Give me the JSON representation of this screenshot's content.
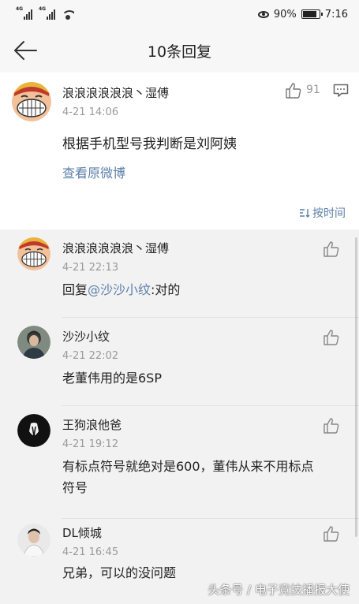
{
  "status_bar": {
    "sim1": "4G",
    "sim2": "4G",
    "battery": "90%",
    "time": "7:16"
  },
  "header": {
    "title": "10条回复",
    "back_icon": "arrow-left-icon"
  },
  "main_comment": {
    "username": "浪浪浪浪浪浪丶湿傅",
    "time": "4-21 14:06",
    "text": "根据手机型号我判断是刘阿姨",
    "like_count": "91",
    "view_original": "查看原微博",
    "sort_label": "按时间"
  },
  "replies": [
    {
      "username": "浪浪浪浪浪浪丶湿傅",
      "time": "4-21 22:13",
      "prefix": "回复",
      "mention": "@沙沙小纹",
      "text": ":对的"
    },
    {
      "username": "沙沙小纹",
      "time": "4-21 22:02",
      "text": "老董伟用的是6SP"
    },
    {
      "username": "王狗浪他爸",
      "time": "4-21 19:12",
      "text_line1": "有标点符号就绝对是600，董伟从来不用标点",
      "text_line2": "符号"
    },
    {
      "username": "DL倾城",
      "time": "4-21 16:45",
      "text": "兄弟，可以的没问题"
    }
  ],
  "watermark": "头条号 / 电子竞技播报大使",
  "colors": {
    "link": "#5b7fa8",
    "background": "#f2f2f2",
    "card": "#ffffff"
  }
}
